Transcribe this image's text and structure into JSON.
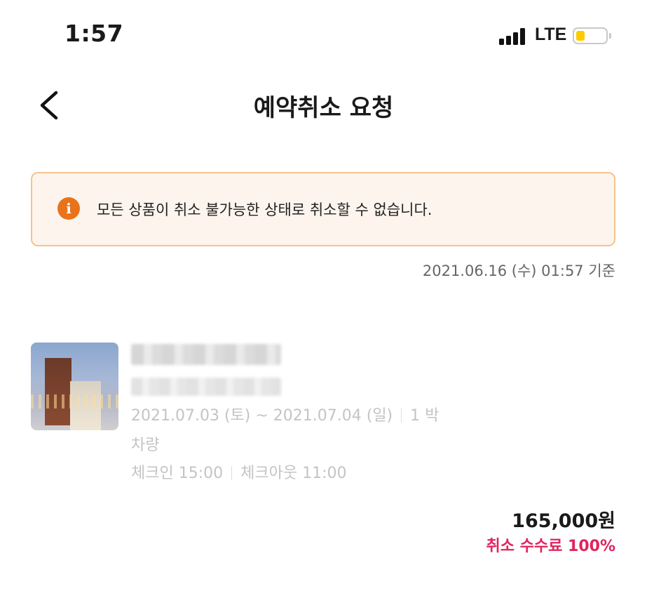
{
  "status_bar": {
    "time": "1:57",
    "network": "LTE",
    "icons": [
      "signal-icon",
      "battery-icon"
    ]
  },
  "header": {
    "back_icon": "chevron-left-icon",
    "title": "예약취소 요청"
  },
  "notice": {
    "icon": "info-icon",
    "icon_glyph": "i",
    "message": "모든 상품이 취소 불가능한 상태로 취소할 수 없습니다."
  },
  "timestamp": "2021.06.16 (수) 01:57 기준",
  "reservation": {
    "date_range": "2021.07.03 (토) ~ 2021.07.04 (일)",
    "nights": "1 박",
    "option": "차량",
    "checkin": "체크인 15:00",
    "checkout": "체크아웃 11:00",
    "price": "165,000원",
    "cancel_fee": "취소 수수료 100%"
  },
  "colors": {
    "accent_orange": "#e8731a",
    "notice_border": "#f5c48d",
    "notice_bg": "#fdf4ed",
    "fee_red": "#e0245e",
    "battery_yellow": "#ffcc00"
  }
}
